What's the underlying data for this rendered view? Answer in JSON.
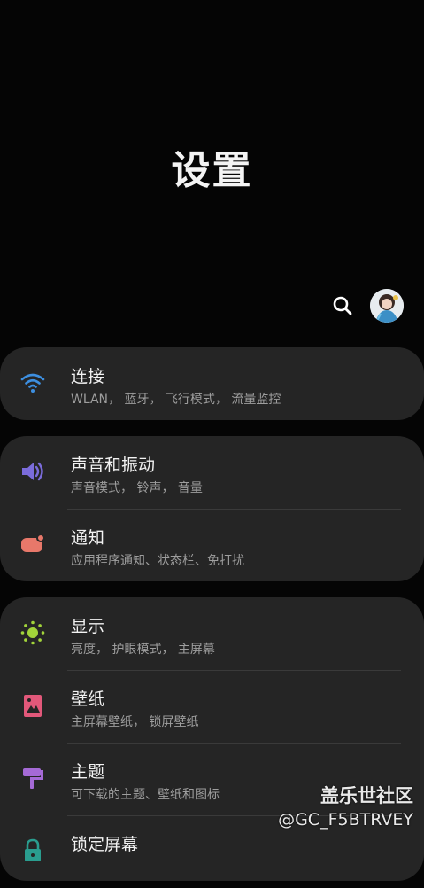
{
  "header": {
    "title": "设置"
  },
  "groups": [
    {
      "items": [
        {
          "label": "连接",
          "sub": "WLAN， 蓝牙， 飞行模式， 流量监控",
          "icon": "wifi-icon",
          "color": "#3d8fe0"
        }
      ]
    },
    {
      "items": [
        {
          "label": "声音和振动",
          "sub": "声音模式， 铃声， 音量",
          "icon": "sound-icon",
          "color": "#7b6cdb"
        },
        {
          "label": "通知",
          "sub": "应用程序通知、状态栏、免打扰",
          "icon": "notification-icon",
          "color": "#e8786a"
        }
      ]
    },
    {
      "items": [
        {
          "label": "显示",
          "sub": "亮度， 护眼模式， 主屏幕",
          "icon": "brightness-icon",
          "color": "#a2d43a"
        },
        {
          "label": "壁纸",
          "sub": "主屏幕壁纸， 锁屏壁纸",
          "icon": "wallpaper-icon",
          "color": "#e2587a"
        },
        {
          "label": "主题",
          "sub": "可下载的主题、壁纸和图标",
          "icon": "theme-brush-icon",
          "color": "#a56ad6"
        },
        {
          "label": "锁定屏幕",
          "sub": "",
          "icon": "lock-icon",
          "color": "#2a9d8f"
        }
      ]
    }
  ],
  "watermark": {
    "line1": "盖乐世社区",
    "line2": "@GC_F5BTRVEY"
  }
}
